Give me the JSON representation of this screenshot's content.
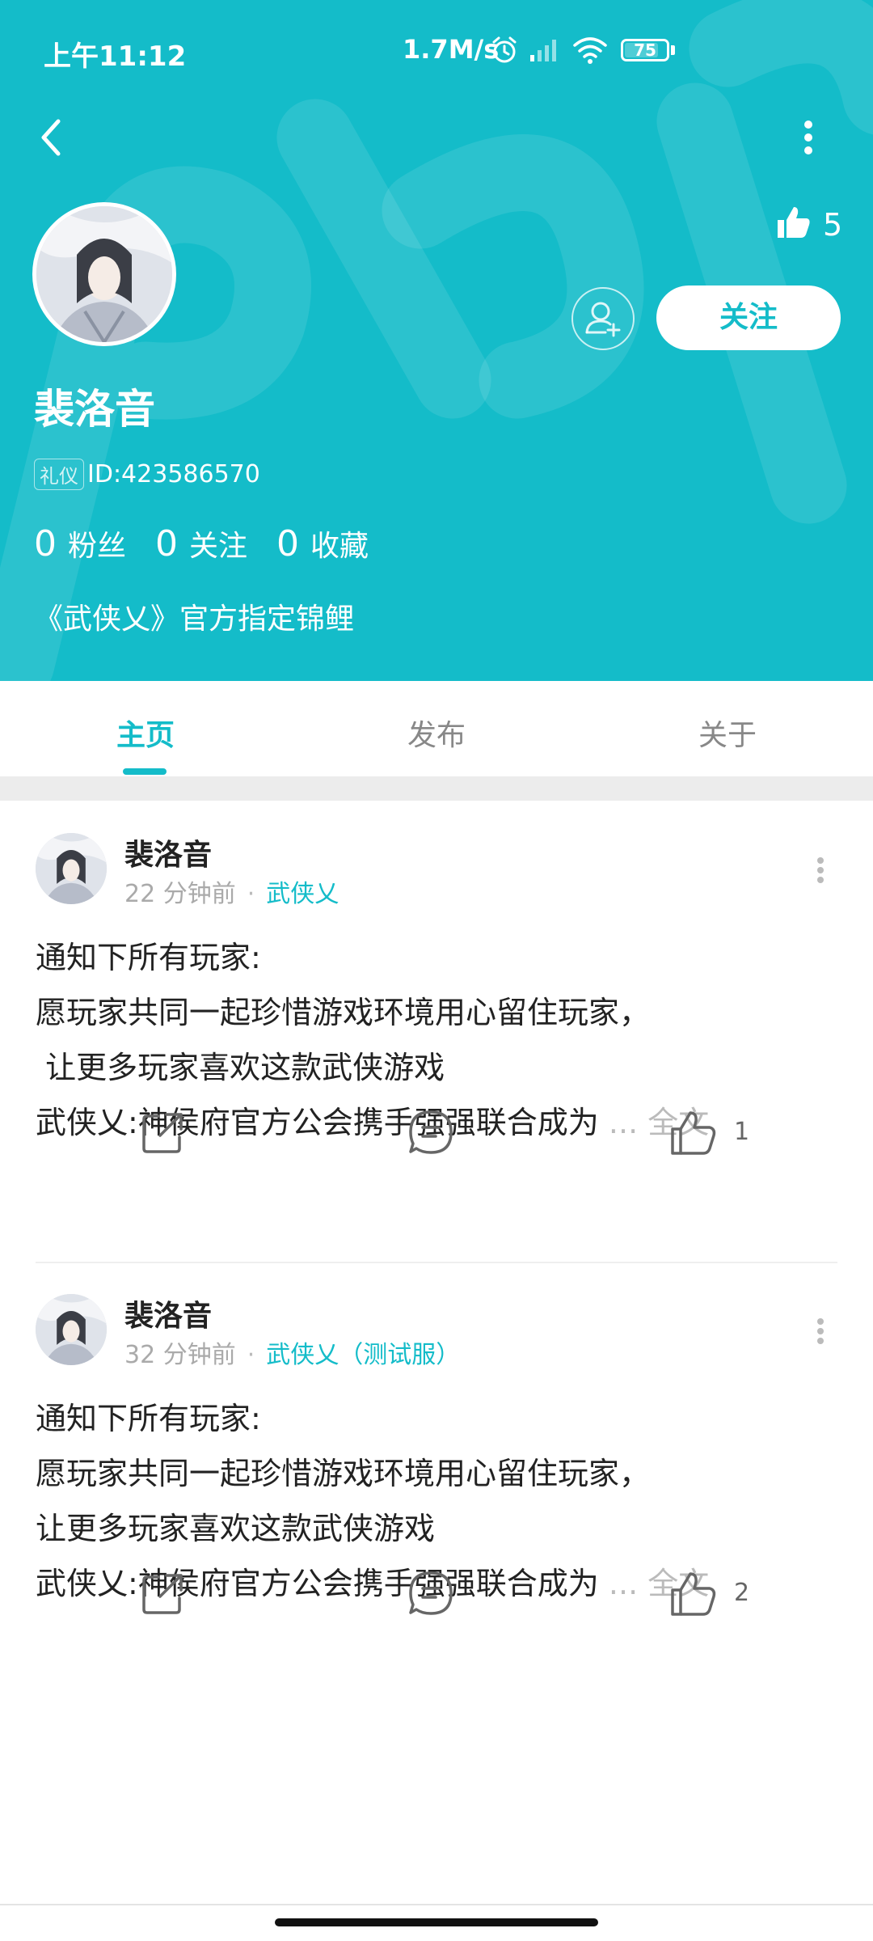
{
  "status_bar": {
    "time": "上午11:12",
    "network_speed": "1.7M/s",
    "battery": "75",
    "icons": [
      "alarm-icon",
      "signal-icon",
      "wifi-icon",
      "battery-icon"
    ]
  },
  "profile": {
    "name": "裴洛音",
    "tag": "礼仪",
    "id_text": "ID:423586570",
    "likes": "5",
    "follow_label": "关注",
    "bio": "《武侠乂》官方指定锦鲤",
    "stats": [
      {
        "num": "0",
        "label": "粉丝"
      },
      {
        "num": "0",
        "label": "关注"
      },
      {
        "num": "0",
        "label": "收藏"
      }
    ]
  },
  "tabs": [
    {
      "label": "主页",
      "active": true
    },
    {
      "label": "发布",
      "active": false
    },
    {
      "label": "关于",
      "active": false
    }
  ],
  "posts": [
    {
      "author": "裴洛音",
      "time": "22 分钟前",
      "game": "武侠乂",
      "lines": [
        "通知下所有玩家:",
        "愿玩家共同一起珍惜游戏环境用心留住玩家，",
        " 让更多玩家喜欢这款武侠游戏",
        "武侠乂:神侯府官方公会携手强强联合成为"
      ],
      "ellipsis": "...",
      "more_label": "全文",
      "likes": "1"
    },
    {
      "author": "裴洛音",
      "time": "32 分钟前",
      "game": "武侠乂（测试服）",
      "lines": [
        "通知下所有玩家:",
        "愿玩家共同一起珍惜游戏环境用心留住玩家，",
        "让更多玩家喜欢这款武侠游戏",
        "武侠乂:神侯府官方公会携手强强联合成为"
      ],
      "ellipsis": "...",
      "more_label": "全文",
      "likes": "2"
    }
  ],
  "colors": {
    "accent": "#14bcc9",
    "header_bg": "#14bcc9"
  }
}
